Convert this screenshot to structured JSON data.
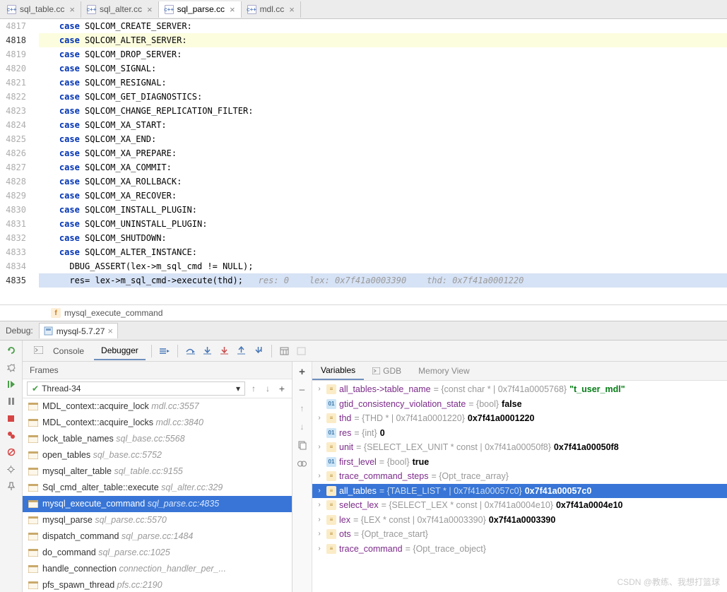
{
  "tabs": [
    {
      "label": "sql_table.cc",
      "active": false
    },
    {
      "label": "sql_alter.cc",
      "active": false
    },
    {
      "label": "sql_parse.cc",
      "active": true
    },
    {
      "label": "mdl.cc",
      "active": false
    }
  ],
  "editor": {
    "lines": [
      {
        "num": "4817",
        "kw": "case",
        "tok": "SQLCOM_CREATE_SERVER",
        "colon": ":"
      },
      {
        "num": "4818",
        "kw": "case",
        "tok": "SQLCOM_ALTER_SERVER",
        "colon": ":",
        "hl": true
      },
      {
        "num": "4819",
        "kw": "case",
        "tok": "SQLCOM_DROP_SERVER",
        "colon": ":"
      },
      {
        "num": "4820",
        "kw": "case",
        "tok": "SQLCOM_SIGNAL",
        "colon": ":"
      },
      {
        "num": "4821",
        "kw": "case",
        "tok": "SQLCOM_RESIGNAL",
        "colon": ":"
      },
      {
        "num": "4822",
        "kw": "case",
        "tok": "SQLCOM_GET_DIAGNOSTICS",
        "colon": ":"
      },
      {
        "num": "4823",
        "kw": "case",
        "tok": "SQLCOM_CHANGE_REPLICATION_FILTER",
        "colon": ":"
      },
      {
        "num": "4824",
        "kw": "case",
        "tok": "SQLCOM_XA_START",
        "colon": ":"
      },
      {
        "num": "4825",
        "kw": "case",
        "tok": "SQLCOM_XA_END",
        "colon": ":"
      },
      {
        "num": "4826",
        "kw": "case",
        "tok": "SQLCOM_XA_PREPARE",
        "colon": ":"
      },
      {
        "num": "4827",
        "kw": "case",
        "tok": "SQLCOM_XA_COMMIT",
        "colon": ":"
      },
      {
        "num": "4828",
        "kw": "case",
        "tok": "SQLCOM_XA_ROLLBACK",
        "colon": ":"
      },
      {
        "num": "4829",
        "kw": "case",
        "tok": "SQLCOM_XA_RECOVER",
        "colon": ":"
      },
      {
        "num": "4830",
        "kw": "case",
        "tok": "SQLCOM_INSTALL_PLUGIN",
        "colon": ":"
      },
      {
        "num": "4831",
        "kw": "case",
        "tok": "SQLCOM_UNINSTALL_PLUGIN",
        "colon": ":"
      },
      {
        "num": "4832",
        "kw": "case",
        "tok": "SQLCOM_SHUTDOWN",
        "colon": ":"
      },
      {
        "num": "4833",
        "kw": "case",
        "tok": "SQLCOM_ALTER_INSTANCE",
        "colon": ":"
      }
    ],
    "assert_line": {
      "num": "4834",
      "text": "DBUG_ASSERT(lex->m_sql_cmd != NULL);"
    },
    "exec_line": {
      "num": "4835",
      "code": "res= lex->m_sql_cmd->execute(thd);",
      "hint": "   res: 0    lex: 0x7f41a0003390    thd: 0x7f41a0001220"
    }
  },
  "breadcrumb": {
    "func": "mysql_execute_command"
  },
  "debug": {
    "label": "Debug:",
    "session": "mysql-5.7.27",
    "toolbar_tabs": {
      "console": "Console",
      "debugger": "Debugger"
    }
  },
  "frames": {
    "header": "Frames",
    "thread": "Thread-34",
    "items": [
      {
        "name": "MDL_context::acquire_lock",
        "loc": "mdl.cc:3557"
      },
      {
        "name": "MDL_context::acquire_locks",
        "loc": "mdl.cc:3840"
      },
      {
        "name": "lock_table_names",
        "loc": "sql_base.cc:5568"
      },
      {
        "name": "open_tables",
        "loc": "sql_base.cc:5752"
      },
      {
        "name": "mysql_alter_table",
        "loc": "sql_table.cc:9155"
      },
      {
        "name": "Sql_cmd_alter_table::execute",
        "loc": "sql_alter.cc:329"
      },
      {
        "name": "mysql_execute_command",
        "loc": "sql_parse.cc:4835",
        "sel": true
      },
      {
        "name": "mysql_parse",
        "loc": "sql_parse.cc:5570"
      },
      {
        "name": "dispatch_command",
        "loc": "sql_parse.cc:1484"
      },
      {
        "name": "do_command",
        "loc": "sql_parse.cc:1025"
      },
      {
        "name": "handle_connection",
        "loc": "connection_handler_per_..."
      },
      {
        "name": "pfs_spawn_thread",
        "loc": "pfs.cc:2190"
      }
    ]
  },
  "vars": {
    "tabs": {
      "variables": "Variables",
      "gdb": "GDB",
      "memory": "Memory View"
    },
    "items": [
      {
        "icon": "struct",
        "name": "all_tables->table_name",
        "type": " = {const char * | 0x7f41a0005768} ",
        "val": "\"t_user_mdl\"",
        "str": true,
        "exp": true
      },
      {
        "icon": "prim",
        "name": "gtid_consistency_violation_state",
        "type": " = {bool} ",
        "val": "false"
      },
      {
        "icon": "struct",
        "name": "thd",
        "type": " = {THD * | 0x7f41a0001220} ",
        "val": "0x7f41a0001220",
        "exp": true
      },
      {
        "icon": "prim",
        "name": "res",
        "type": " = {int} ",
        "val": "0"
      },
      {
        "icon": "struct",
        "name": "unit",
        "type": " = {SELECT_LEX_UNIT * const | 0x7f41a00050f8} ",
        "val": "0x7f41a00050f8",
        "exp": true
      },
      {
        "icon": "prim",
        "name": "first_level",
        "type": " = {bool} ",
        "val": "true"
      },
      {
        "icon": "struct",
        "name": "trace_command_steps",
        "type": " = {Opt_trace_array}",
        "val": "",
        "exp": true
      },
      {
        "icon": "struct",
        "name": "all_tables",
        "type": " = {TABLE_LIST * | 0x7f41a00057c0} ",
        "val": "0x7f41a00057c0",
        "exp": true,
        "sel": true
      },
      {
        "icon": "struct",
        "name": "select_lex",
        "type": " = {SELECT_LEX * const | 0x7f41a0004e10} ",
        "val": "0x7f41a0004e10",
        "exp": true
      },
      {
        "icon": "struct",
        "name": "lex",
        "type": " = {LEX * const | 0x7f41a0003390} ",
        "val": "0x7f41a0003390",
        "exp": true
      },
      {
        "icon": "struct",
        "name": "ots",
        "type": " = {Opt_trace_start}",
        "val": "",
        "exp": true
      },
      {
        "icon": "struct",
        "name": "trace_command",
        "type": " = {Opt_trace_object}",
        "val": "",
        "exp": true
      }
    ]
  },
  "watermark": "CSDN @教练、我想打篮球"
}
